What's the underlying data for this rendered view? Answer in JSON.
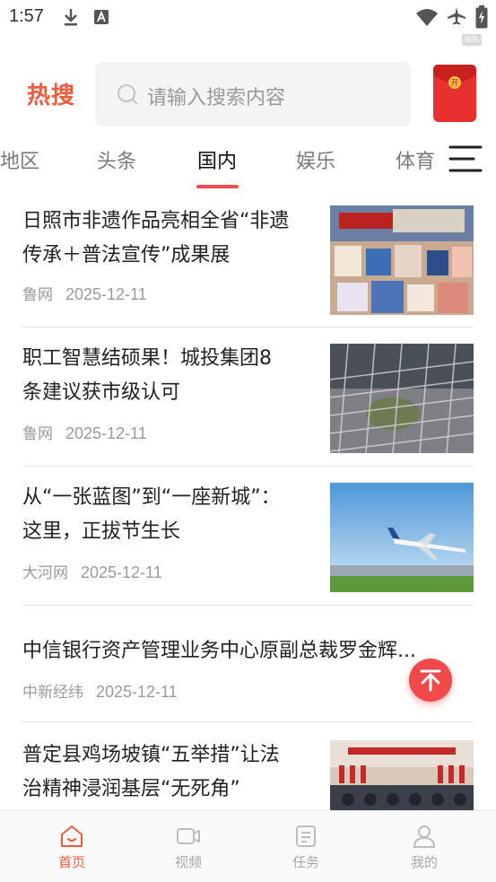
{
  "status_bar": {
    "time": "1:57",
    "speed": "8l/h"
  },
  "header": {
    "brand": "热搜",
    "search_placeholder": "请输入搜索内容",
    "red_packet_icon": "red-packet-icon"
  },
  "tabs": [
    {
      "label": "地区"
    },
    {
      "label": "头条"
    },
    {
      "label": "国内",
      "active": true
    },
    {
      "label": "娱乐"
    },
    {
      "label": "体育"
    }
  ],
  "news": [
    {
      "title_line1": "日照市非遗作品亮相全省“非遗",
      "title_line2": "传承＋普法宣传”成果展",
      "source": "鲁网",
      "date": "2025-12-11",
      "has_image": true
    },
    {
      "title_line1": "职工智慧结硕果！城投集团8",
      "title_line2": "条建议获市级认可",
      "source": "鲁网",
      "date": "2025-12-11",
      "has_image": true
    },
    {
      "title_line1": "从“一张蓝图”到“一座新城”：",
      "title_line2": "这里，正拔节生长",
      "source": "大河网",
      "date": "2025-12-11",
      "has_image": true
    },
    {
      "title_line1": "中信银行资产管理业务中心原副总裁罗金辉...",
      "source": "中新经纬",
      "date": "2025-12-11",
      "has_image": false
    },
    {
      "title_line1": "普定县鸡场坡镇“五举措”让法",
      "title_line2": "治精神浸润基层“无死角”",
      "has_image": true
    }
  ],
  "bottom_nav": [
    {
      "label": "首页",
      "icon": "home-icon",
      "active": true
    },
    {
      "label": "视频",
      "icon": "video-icon"
    },
    {
      "label": "任务",
      "icon": "task-icon"
    },
    {
      "label": "我的",
      "icon": "profile-icon"
    }
  ],
  "colors": {
    "accent": "#f25a3c",
    "active_underline": "#f24b4b",
    "muted": "#9b9b9b"
  }
}
